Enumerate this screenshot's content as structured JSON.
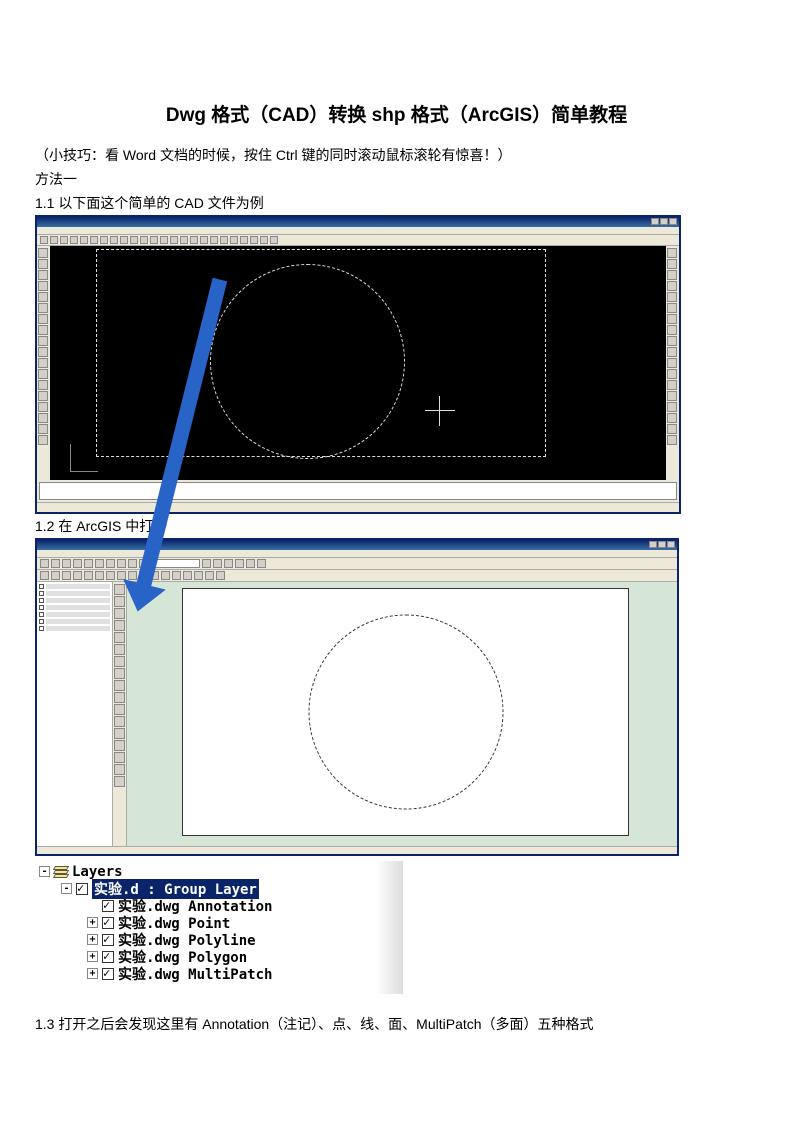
{
  "title": "Dwg 格式（CAD）转换 shp 格式（ArcGIS）简单教程",
  "tip": "（小技巧：看 Word 文档的时候，按住 Ctrl 键的同时滚动鼠标滚轮有惊喜！）",
  "method": "方法一",
  "step_1_1": "1.1 以下面这个简单的 CAD 文件为例",
  "step_1_2": "1.2 在 ArcGIS 中打开",
  "step_1_3": "1.3 打开之后会发现这里有 Annotation（注记）、点、线、面、MultiPatch（多面）五种格式",
  "layers_panel": {
    "root": "Layers",
    "group": "实验.d : Group Layer",
    "items": [
      "实验.dwg Annotation",
      "实验.dwg Point",
      "实验.dwg Polyline",
      "实验.dwg Polygon",
      "实验.dwg MultiPatch"
    ]
  }
}
